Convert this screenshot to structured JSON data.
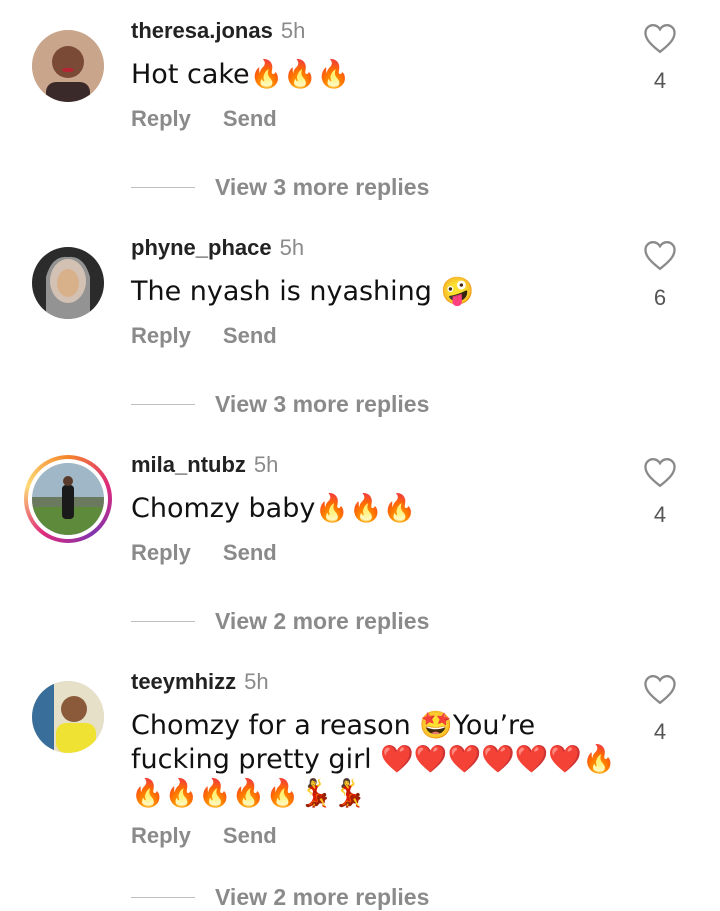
{
  "comments": [
    {
      "username": "theresa.jonas",
      "time": "5h",
      "text": "Hot cake🔥🔥🔥",
      "likes": "4",
      "reply": "Reply",
      "send": "Send",
      "view_more": "View 3 more replies"
    },
    {
      "username": "phyne_phace",
      "time": "5h",
      "text": "The nyash is nyashing 🤪",
      "likes": "6",
      "reply": "Reply",
      "send": "Send",
      "view_more": "View 3 more replies"
    },
    {
      "username": "mila_ntubz",
      "time": "5h",
      "text": "Chomzy baby🔥🔥🔥",
      "likes": "4",
      "reply": "Reply",
      "send": "Send",
      "view_more": "View 2 more replies"
    },
    {
      "username": "teeymhizz",
      "time": "5h",
      "text": "Chomzy for a reason 🤩You’re fucking pretty girl ❤️❤️❤️❤️❤️❤️🔥🔥🔥🔥🔥🔥💃💃",
      "likes": "4",
      "reply": "Reply",
      "send": "Send",
      "view_more": "View 2 more replies"
    }
  ],
  "icons": {
    "heart": "heart-outline-icon"
  },
  "colors": {
    "muted": "#8a8a8a",
    "text": "#111111"
  }
}
